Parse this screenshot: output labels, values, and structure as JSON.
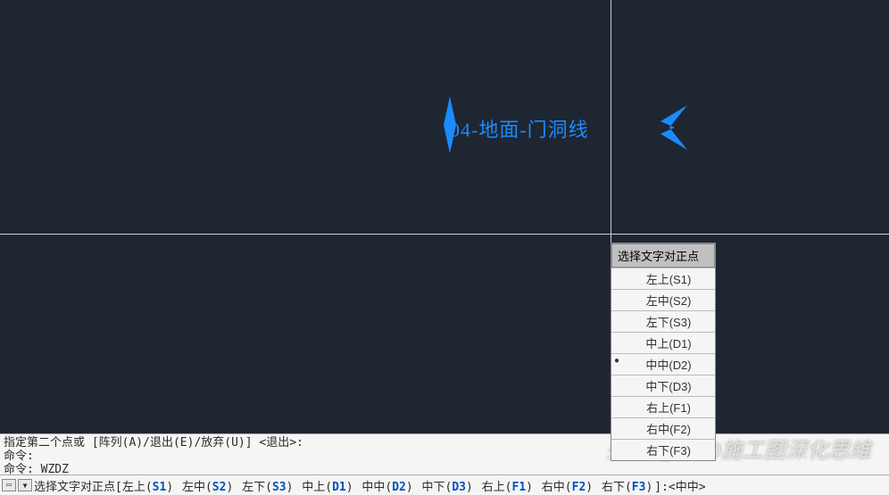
{
  "canvas": {
    "text_label": "04-地面-门洞线",
    "label_color": "#1a8bff",
    "background": "#1e2631"
  },
  "popup": {
    "title": "选择文字对正点",
    "items": [
      {
        "label": "左上(S1)",
        "selected": false
      },
      {
        "label": "左中(S2)",
        "selected": false
      },
      {
        "label": "左下(S3)",
        "selected": false
      },
      {
        "label": "中上(D1)",
        "selected": false
      },
      {
        "label": "中中(D2)",
        "selected": true
      },
      {
        "label": "中下(D3)",
        "selected": false
      },
      {
        "label": "右上(F1)",
        "selected": false
      },
      {
        "label": "右中(F2)",
        "selected": false
      },
      {
        "label": "右下(F3)",
        "selected": false
      }
    ]
  },
  "history": {
    "line1": "指定第二个点或 [阵列(A)/退出(E)/放弃(U)] <退出>:",
    "line2": "命令:",
    "line3": "命令: WZDZ"
  },
  "cmdline": {
    "prefix": "选择文字对正点[",
    "options": [
      {
        "txt": "左上(",
        "key": "S1",
        "tail": ")"
      },
      {
        "txt": " 左中(",
        "key": "S2",
        "tail": ")"
      },
      {
        "txt": " 左下(",
        "key": "S3",
        "tail": ")"
      },
      {
        "txt": " 中上(",
        "key": "D1",
        "tail": ")"
      },
      {
        "txt": " 中中(",
        "key": "D2",
        "tail": ")"
      },
      {
        "txt": " 中下(",
        "key": "D3",
        "tail": ")"
      },
      {
        "txt": " 右上(",
        "key": "F1",
        "tail": ")"
      },
      {
        "txt": " 右中(",
        "key": "F2",
        "tail": ")"
      },
      {
        "txt": " 右下(",
        "key": "F3",
        "tail": ")"
      }
    ],
    "suffix": "]:<中中>",
    "caret": "▼"
  },
  "watermark": "头条 @CAD施工图深化思维"
}
